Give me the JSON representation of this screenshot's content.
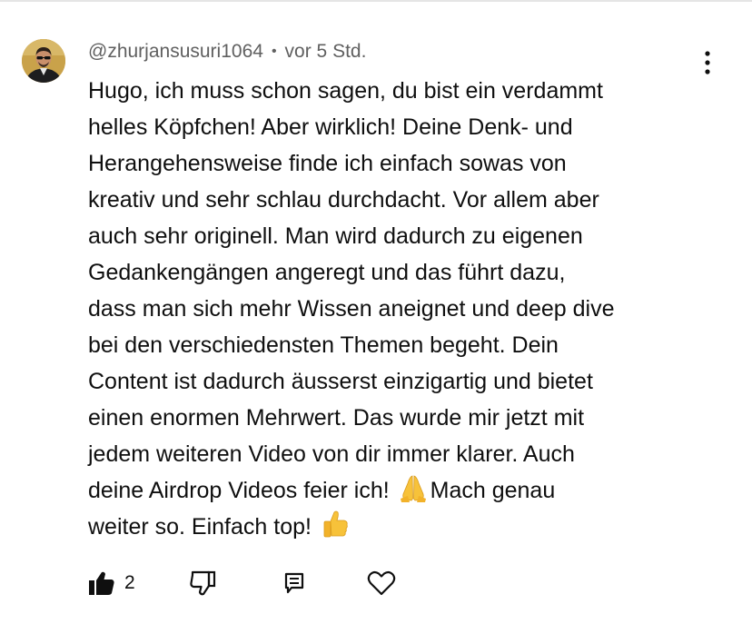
{
  "comment": {
    "author": "@zhurjansusuri1064",
    "separator": "•",
    "timestamp": "vor 5 Std.",
    "body_lines": [
      "Hugo, ich muss schon sagen, du bist ein verdammt",
      "helles Köpfchen! Aber wirklich! Deine Denk- und",
      "Herangehensweise finde ich einfach sowas von",
      "kreativ und sehr schlau durchdacht. Vor allem aber",
      "auch sehr originell. Man wird dadurch zu eigenen",
      "Gedankengängen angeregt und das führt dazu,",
      "dass man sich mehr Wissen aneignet und deep dive",
      "bei den verschiedensten Themen begeht. Dein",
      "Content ist dadurch äusserst einzigartig und bietet",
      "einen enormen Mehrwert. Das wurde mir jetzt mit",
      "jedem weiteren Video von dir immer klarer. Auch"
    ],
    "body_line_12_before": "deine Airdrop Videos feier ich! ",
    "body_line_12_emoji": "folded-hands-emoji",
    "body_line_12_after": "Mach genau",
    "body_line_13_text": "weiter so. Einfach top! ",
    "body_line_13_emoji": "thumbs-up-emoji",
    "like_count": "2"
  },
  "icons": {
    "menu": "more-vert-icon",
    "like": "thumbs-up-filled-icon",
    "dislike": "thumbs-down-outline-icon",
    "reply": "reply-comment-icon",
    "heart": "heart-outline-icon"
  },
  "colors": {
    "text": "#0f0f0f",
    "secondary_text": "#606060",
    "emoji_yellow": "#f7c23a"
  }
}
